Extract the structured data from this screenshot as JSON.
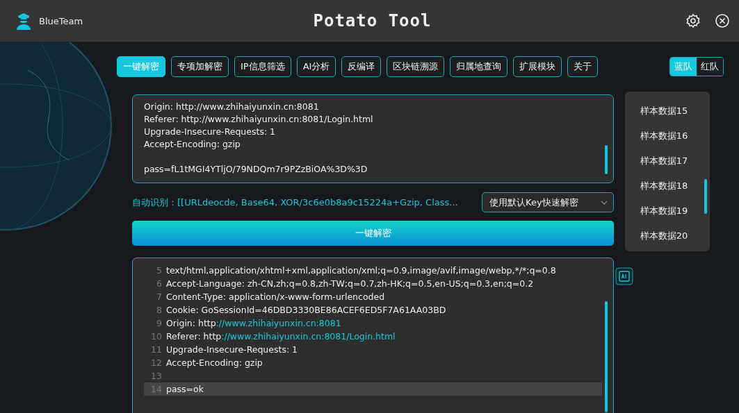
{
  "app": {
    "user": "BlueTeam",
    "title": "Potato Tool"
  },
  "tabs": [
    {
      "label": "一键解密",
      "selected": true
    },
    {
      "label": "专项加解密",
      "selected": false
    },
    {
      "label": "IP信息筛选",
      "selected": false
    },
    {
      "label": "AI分析",
      "selected": false
    },
    {
      "label": "反编译",
      "selected": false
    },
    {
      "label": "区块链溯源",
      "selected": false
    },
    {
      "label": "归属地查询",
      "selected": false
    },
    {
      "label": "扩展模块",
      "selected": false
    },
    {
      "label": "关于",
      "selected": false
    }
  ],
  "team_toggle": [
    {
      "label": "蓝队",
      "selected": true
    },
    {
      "label": "红队",
      "selected": false
    }
  ],
  "input": {
    "headers": [
      "Origin: http://www.zhihaiyunxin.cn:8081",
      "Referer: http://www.zhihaiyunxin.cn:8081/Login.html",
      "Upgrade-Insecure-Requests: 1",
      "Accept-Encoding: gzip"
    ],
    "body": "pass=fL1tMGI4YTljO/79NDQm7r9PZzBiOA%3D%3D"
  },
  "auto_detect": {
    "label": "自动识别：",
    "value": "[[URLdeocde, Base64, XOR/3c6e0b8a9c15224a+Gzip, Class..."
  },
  "mode_select": {
    "value": "使用默认Key快速解密"
  },
  "decrypt_button": "一键解密",
  "samples": [
    {
      "label": "样本数据15"
    },
    {
      "label": "样本数据16"
    },
    {
      "label": "样本数据17"
    },
    {
      "label": "样本数据18"
    },
    {
      "label": "样本数据19"
    },
    {
      "label": "样本数据20"
    }
  ],
  "output": {
    "lines": [
      {
        "num": "5",
        "text": "text/html,application/xhtml+xml,application/xml;q=0.9,image/avif,image/webp,*/*;q=0.8",
        "current": false
      },
      {
        "num": "6",
        "text": "Accept-Language: zh-CN,zh;q=0.8,zh-TW;q=0.7,zh-HK;q=0.5,en-US;q=0.3,en;q=0.2",
        "current": false
      },
      {
        "num": "7",
        "text": "Content-Type: application/x-www-form-urlencoded",
        "current": false
      },
      {
        "num": "8",
        "text": "Cookie: GoSessionId=46DBD3330BE86ACEF6ED5F7A61AA03BD",
        "current": false
      },
      {
        "num": "9",
        "text": "Origin: http",
        "link": "://www.zhihaiyunxin.cn:8081",
        "current": false
      },
      {
        "num": "10",
        "text": "Referer: http",
        "link": "://www.zhihaiyunxin.cn:8081/Login.html",
        "current": false
      },
      {
        "num": "11",
        "text": "Upgrade-Insecure-Requests: 1",
        "current": false
      },
      {
        "num": "12",
        "text": "Accept-Encoding: gzip",
        "current": false
      },
      {
        "num": "13",
        "current": false
      },
      {
        "num": "14",
        "text": "pass=ok",
        "current": true
      }
    ]
  }
}
